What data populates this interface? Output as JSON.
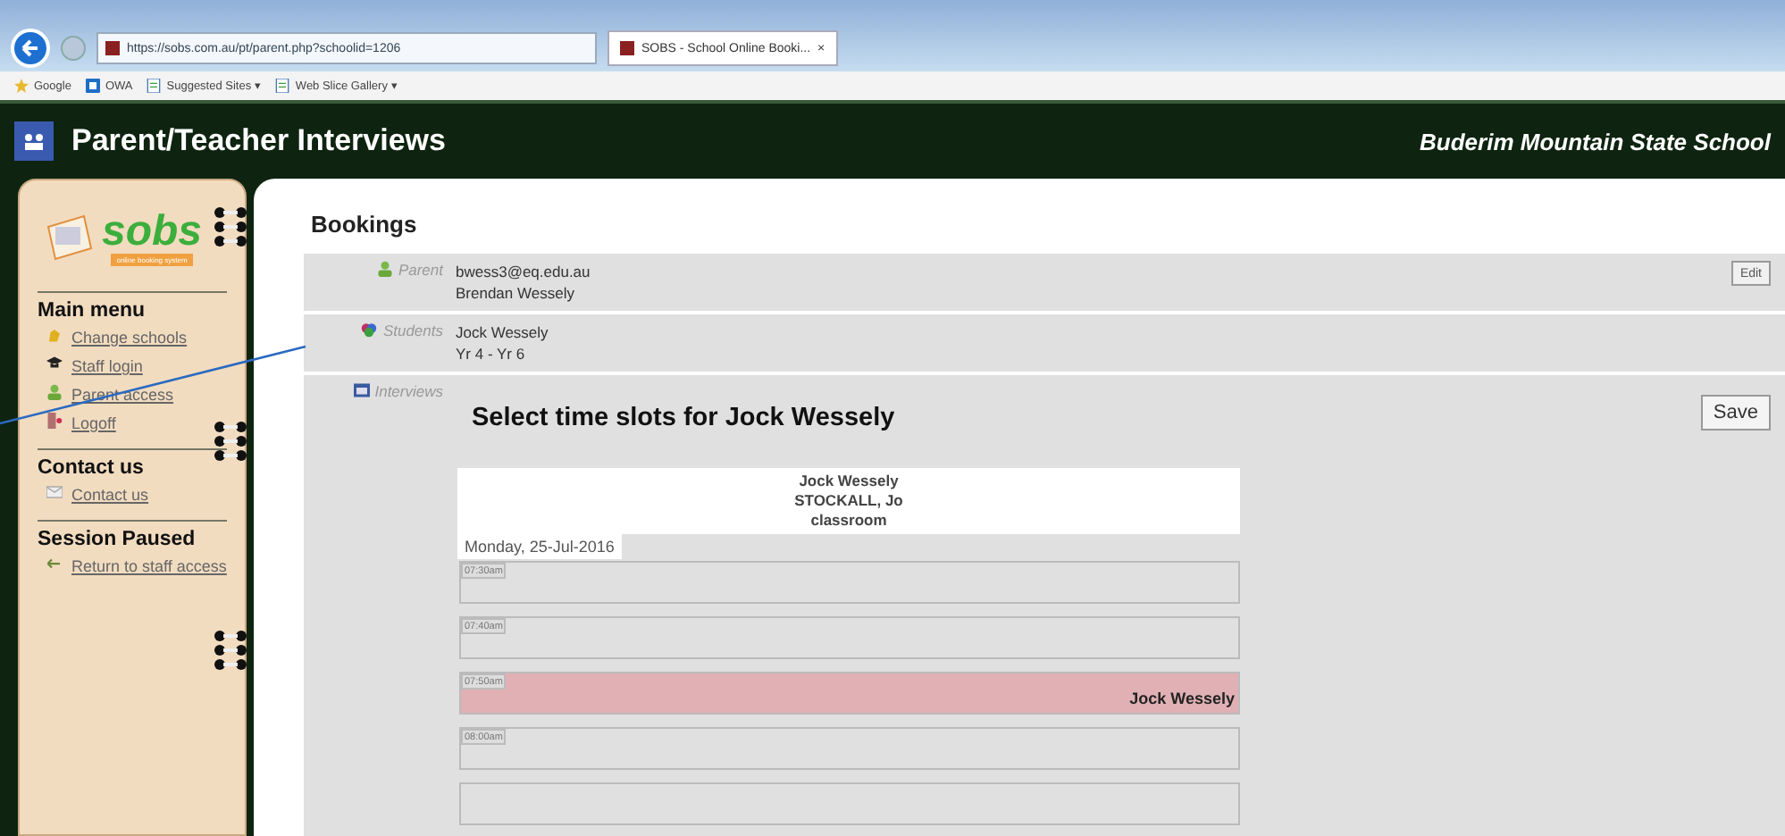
{
  "browser": {
    "url": "https://sobs.com.au/pt/parent.php?schoolid=1206",
    "tab_title": "SOBS - School Online Booki...",
    "tab_close": "×",
    "favorites": [
      {
        "label": "Google",
        "kind": "google"
      },
      {
        "label": "OWA",
        "kind": "owa"
      },
      {
        "label": "Suggested Sites ▾",
        "kind": "page"
      },
      {
        "label": "Web Slice Gallery ▾",
        "kind": "page"
      }
    ]
  },
  "header": {
    "title": "Parent/Teacher Interviews",
    "school": "Buderim Mountain State School"
  },
  "sidebar": {
    "logo": "sobs",
    "tagline": "online booking system",
    "sections": [
      {
        "heading": "Main menu",
        "items": [
          {
            "label": "Change schools",
            "kind": "schools"
          },
          {
            "label": "Staff login",
            "kind": "staff"
          },
          {
            "label": "Parent access",
            "kind": "parent"
          },
          {
            "label": "Logoff",
            "kind": "logoff"
          }
        ]
      },
      {
        "heading": "Contact us",
        "items": [
          {
            "label": "Contact us",
            "kind": "mail"
          }
        ]
      },
      {
        "heading": "Session Paused",
        "items": [
          {
            "label": "Return to staff access",
            "kind": "return"
          }
        ]
      }
    ]
  },
  "main": {
    "heading": "Bookings",
    "details": [
      {
        "label": "Parent",
        "kind": "parent",
        "lines": [
          "bwess3@eq.edu.au",
          "Brendan Wessely"
        ],
        "button": "Edit"
      },
      {
        "label": "Students",
        "kind": "students",
        "lines": [
          "Jock Wessely",
          "Yr 4 - Yr 6"
        ]
      }
    ],
    "interviews": {
      "label": "Interviews",
      "heading": "Select time slots for Jock Wessely",
      "save": "Save",
      "card": [
        "Jock Wessely",
        "STOCKALL, Jo",
        "classroom"
      ],
      "date": "Monday, 25-Jul-2016",
      "slots": [
        {
          "time": "07:30am",
          "booked": false
        },
        {
          "time": "07:40am",
          "booked": false
        },
        {
          "time": "07:50am",
          "booked": true,
          "student": "Jock Wessely"
        },
        {
          "time": "08:00am",
          "booked": false
        },
        {
          "booked": false
        }
      ]
    }
  }
}
